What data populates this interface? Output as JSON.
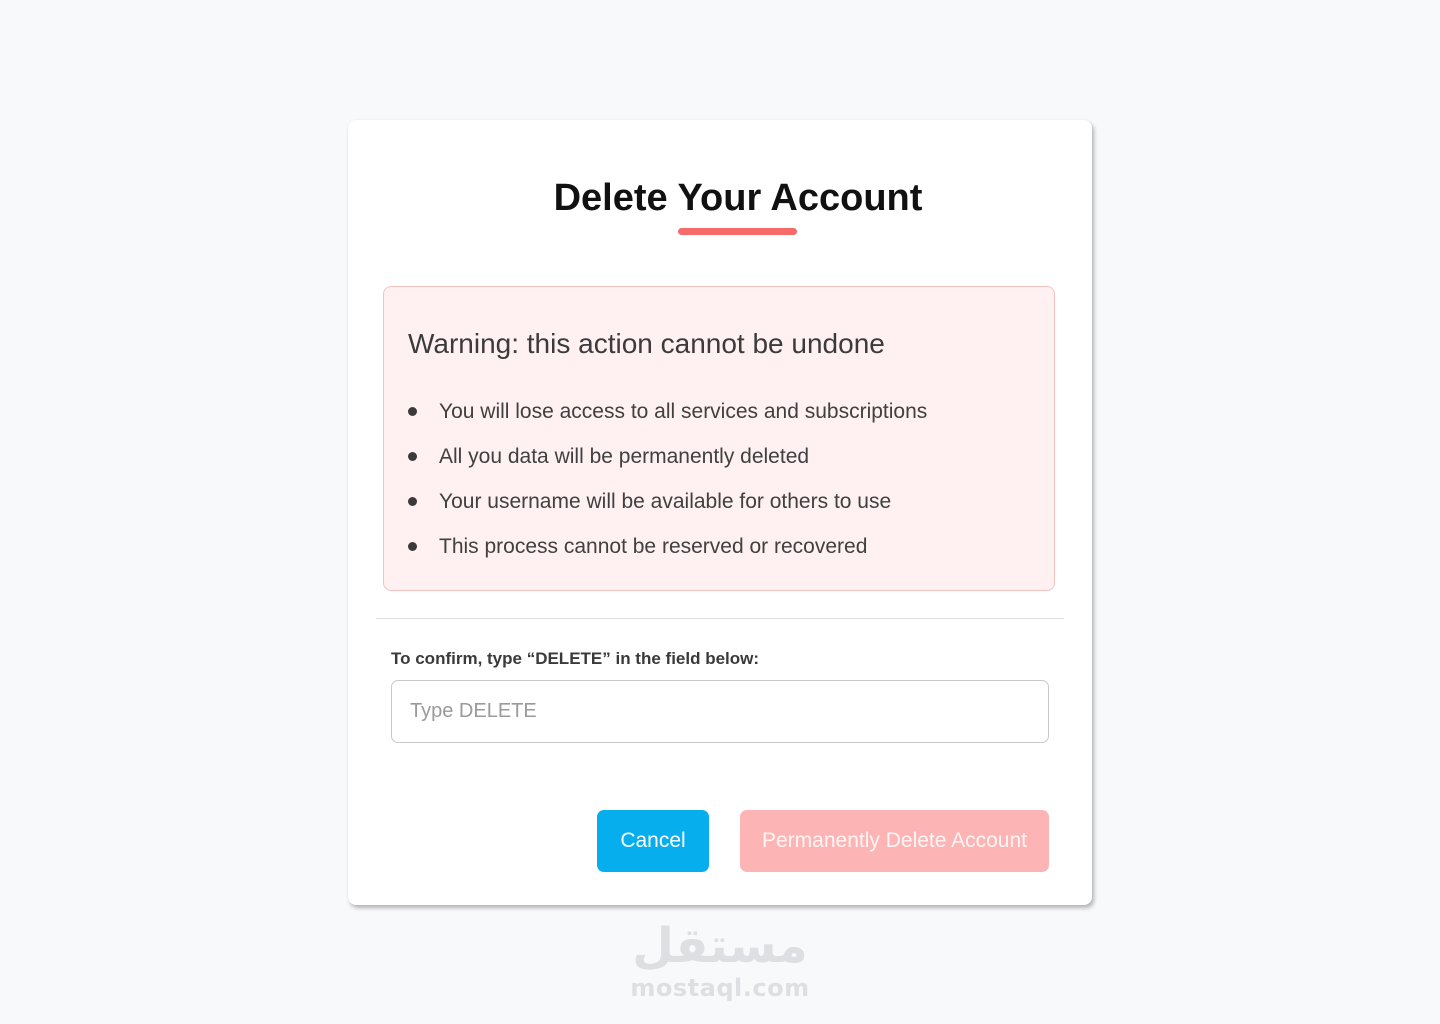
{
  "dialog": {
    "title": "Delete Your Account"
  },
  "warning": {
    "title": "Warning: this action cannot be undone",
    "items": [
      "You will lose access to all services and subscriptions",
      "All you data will be permanently deleted",
      "Your username will be available for others to use",
      "This process cannot be reserved or recovered"
    ]
  },
  "confirm": {
    "label": "To confirm, type “DELETE” in the field below:",
    "value": "",
    "placeholder": "Type DELETE"
  },
  "buttons": {
    "cancel": "Cancel",
    "delete": "Permanently Delete Account"
  },
  "watermark": {
    "arabic": "مستقل",
    "latin": "mostaql.com"
  },
  "colors": {
    "page_background": "#f8f9fb",
    "accent_underline": "#f76a6a",
    "warning_background": "#fff1f1",
    "cancel_button": "#06aeee",
    "delete_button_disabled": "#fdb4b4"
  }
}
